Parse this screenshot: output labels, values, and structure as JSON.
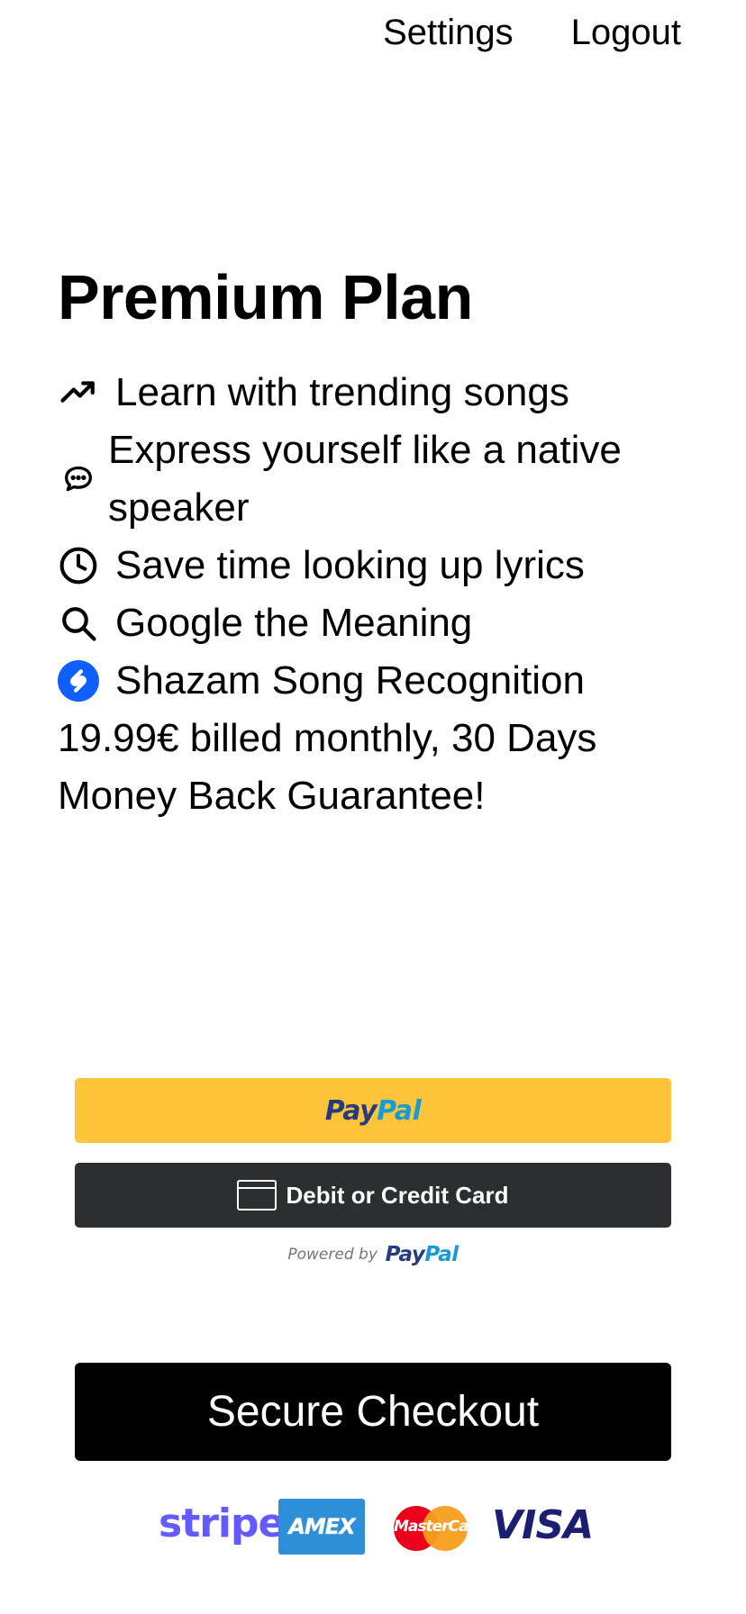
{
  "nav": {
    "settings": "Settings",
    "logout": "Logout"
  },
  "plan": {
    "title": "Premium Plan"
  },
  "features": [
    {
      "icon": "trending-up-icon",
      "text": "Learn with trending songs"
    },
    {
      "icon": "chat-bubble-icon",
      "text": "Express yourself like a native speaker"
    },
    {
      "icon": "clock-icon",
      "text": "Save time looking up lyrics"
    },
    {
      "icon": "search-icon",
      "text": "Google the Meaning"
    },
    {
      "icon": "shazam-icon",
      "text": "Shazam Song Recognition"
    }
  ],
  "pricing": "19.99€ billed monthly, 30 Days Money Back Guarantee!",
  "paypal": {
    "button_pay": "Pay",
    "button_pal": "Pal",
    "card_label": "Debit or Credit Card",
    "powered_by": "Powered by",
    "powered_pay": "Pay",
    "powered_pal": "Pal",
    "button_color": "#ffc439",
    "card_button_color": "#2c2e2f"
  },
  "checkout": {
    "label": "Secure Checkout"
  },
  "payment_logos": {
    "stripe": "stripe",
    "amex": "AMEX",
    "mastercard": "MasterCard",
    "visa": "VISA"
  },
  "colors": {
    "shazam": "#0f5fff",
    "stripe": "#635bff",
    "visa": "#1a1f71"
  }
}
